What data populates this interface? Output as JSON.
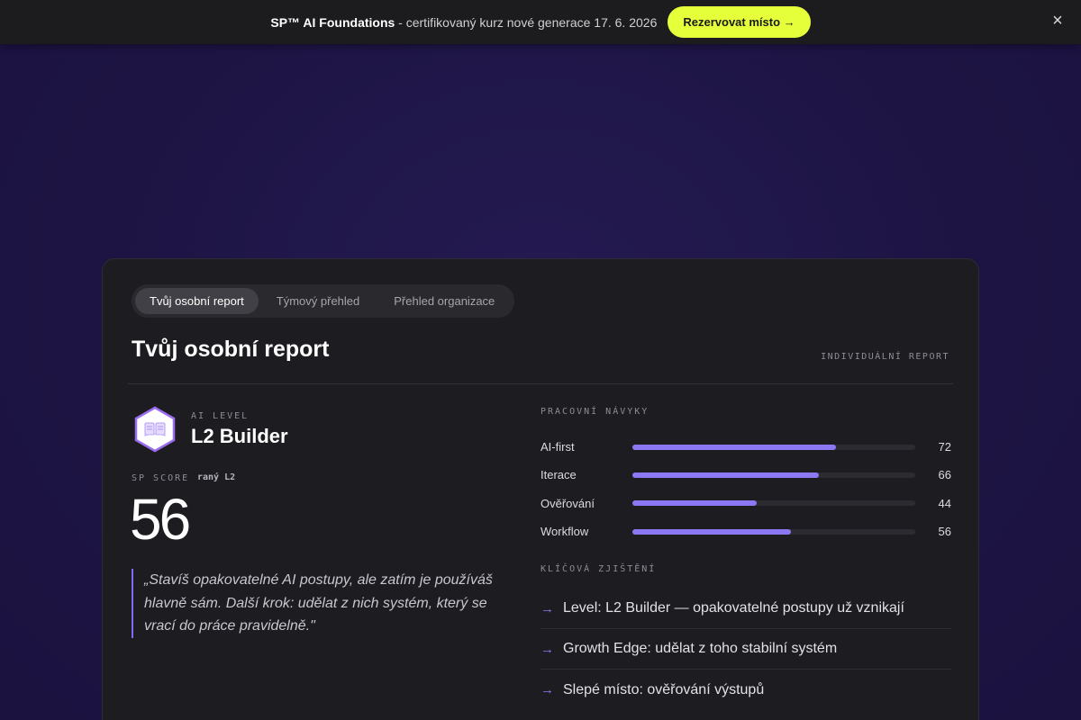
{
  "banner": {
    "title": "SP™ AI Foundations",
    "text": " - certifikovaný kurz nové generace 17. 6. 2026",
    "cta_label": "Rezervovat místo →",
    "close_label": "×"
  },
  "tabs": [
    {
      "label": "Tvůj osobní report",
      "active": true
    },
    {
      "label": "Týmový přehled",
      "active": false
    },
    {
      "label": "Přehled organizace",
      "active": false
    }
  ],
  "report": {
    "title": "Tvůj osobní report",
    "kicker": "INDIVIDUÁLNÍ REPORT"
  },
  "level": {
    "label": "AI LEVEL",
    "name": "L2 Builder",
    "icon": "book-hexagon-icon"
  },
  "score": {
    "label": "SP SCORE",
    "sublabel": "raný L2",
    "value": "56"
  },
  "quote": "„Stavíš opakovatelné AI postupy, ale zatím je používáš hlavně sám. Další krok: udělat z nich systém, který se vrací do práce pravidelně.\"",
  "skills_section": {
    "label": "PRACOVNÍ NÁVYKY",
    "items": [
      {
        "name": "AI-first",
        "value": 72
      },
      {
        "name": "Iterace",
        "value": 66
      },
      {
        "name": "Ověřování",
        "value": 44
      },
      {
        "name": "Workflow",
        "value": 56
      }
    ]
  },
  "findings_section": {
    "label": "KLÍČOVÁ ZJIŠTĚNÍ",
    "arrow": "→",
    "items": [
      "Level: L2 Builder — opakovatelné postupy už vznikají",
      "Growth Edge: udělat z toho stabilní systém",
      "Slepé místo: ověřování výstupů"
    ]
  },
  "colors": {
    "accent": "#8b78f2",
    "cta": "#e5ff3b",
    "background": "#1e1545",
    "card": "#1d1c21"
  }
}
